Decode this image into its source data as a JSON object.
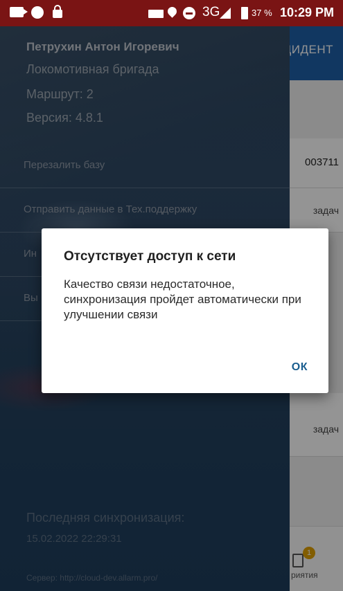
{
  "status_bar": {
    "network": "3G",
    "battery": "37 %",
    "time": "10:29 PM"
  },
  "background_app": {
    "header_title": "ЦИДЕНТ",
    "row1_text": "003711",
    "row2_text": "задач",
    "row3_text": "задач",
    "nav_badge": "1",
    "nav_label": "риятия"
  },
  "drawer": {
    "user_name": "Петрухин Антон Игоревич",
    "role": "Локомотивная бригада",
    "route": "Маршрут: 2",
    "version": "Версия: 4.8.1",
    "menu": [
      {
        "label": "Перезалить базу"
      },
      {
        "label": "Отправить данные в Тех.поддержку"
      },
      {
        "label": "Ин"
      },
      {
        "label": "Вы"
      }
    ],
    "sync_label": "Последняя синхронизация:",
    "sync_time": "15.02.2022 22:29:31",
    "server": "Сервер: http://cloud-dev.allarm.pro/"
  },
  "dialog": {
    "title": "Отсутствует доступ к сети",
    "message": "Качество связи недостаточное, синхронизация пройдет автоматически при улучшении связи",
    "ok_label": "ОК"
  }
}
